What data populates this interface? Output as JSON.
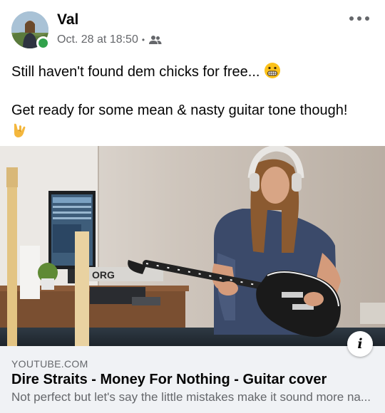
{
  "post": {
    "author": "Val",
    "timestamp": "Oct. 28 at 18:50",
    "separator": "•",
    "audience_icon": "friends-icon",
    "online": true,
    "text_line_1": "Still haven't found dem chicks for free...",
    "emoji_1": "grimacing-face",
    "text_line_2": "Get ready for some mean & nasty guitar tone though!",
    "emoji_2": "sign-of-the-horns"
  },
  "media": {
    "amp_brand": "ORG"
  },
  "link_preview": {
    "domain": "YOUTUBE.COM",
    "title": "Dire Straits - Money For Nothing - Guitar cover",
    "description": "Not perfect but let's say the little mistakes make it sound more na..."
  },
  "colors": {
    "text_primary": "#050505",
    "text_secondary": "#65676b",
    "online_green": "#31a24c",
    "preview_bg": "#f0f2f5"
  }
}
